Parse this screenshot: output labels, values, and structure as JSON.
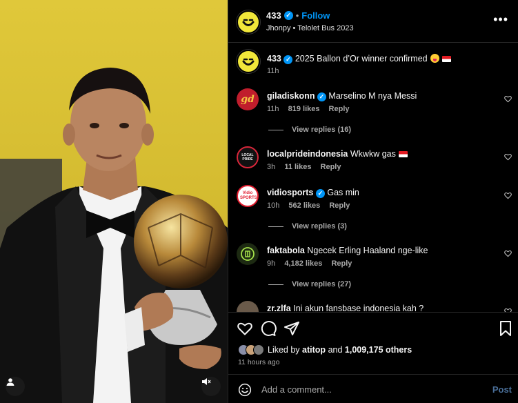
{
  "post": {
    "account": "433",
    "follow_label": "Follow",
    "subtitle": "Jhonpy • Telolet Bus 2023",
    "more_label": "•••"
  },
  "caption": {
    "user": "433",
    "text": "2025 Ballon d’Or winner confirmed",
    "time": "11h"
  },
  "comments": [
    {
      "user": "giladiskonn",
      "verified": true,
      "text": "Marselino M nya Messi",
      "time": "11h",
      "likes": "819 likes",
      "reply": "Reply",
      "view_replies": "View replies (16)"
    },
    {
      "user": "localprideindonesia",
      "verified": false,
      "text": "Wkwkw gas",
      "time": "3h",
      "likes": "11 likes",
      "reply": "Reply",
      "view_replies": ""
    },
    {
      "user": "vidiosports",
      "verified": true,
      "text": "Gas min",
      "time": "10h",
      "likes": "562 likes",
      "reply": "Reply",
      "view_replies": "View replies (3)"
    },
    {
      "user": "faktabola",
      "verified": false,
      "text": "Ngecek Erling Haaland nge-like",
      "time": "9h",
      "likes": "4,182 likes",
      "reply": "Reply",
      "view_replies": "View replies (27)"
    },
    {
      "user": "zr.zlfa",
      "verified": false,
      "text": "Ini akun fansbase indonesia kah ?",
      "time": "",
      "likes": "",
      "reply": "",
      "view_replies": ""
    }
  ],
  "avatar_labels": {
    "giladiskonn": "gd",
    "localpride": "LOCAL PRIDE",
    "vidio": "Vidio SPORTS"
  },
  "likes": {
    "prefix": "Liked by",
    "user": "atitop",
    "and": "and",
    "count": "1,009,175 others",
    "time_ago": "11 hours ago"
  },
  "composer": {
    "placeholder": "Add a comment...",
    "post_label": "Post"
  },
  "colors": {
    "accent": "#0095f6",
    "brand_yellow": "#f1e73a",
    "background": "#000000"
  },
  "icons": [
    "heart-icon",
    "comment-icon",
    "share-icon",
    "bookmark-icon",
    "emoji-icon",
    "mute-icon",
    "tag-user-icon",
    "verified-icon",
    "more-icon"
  ]
}
